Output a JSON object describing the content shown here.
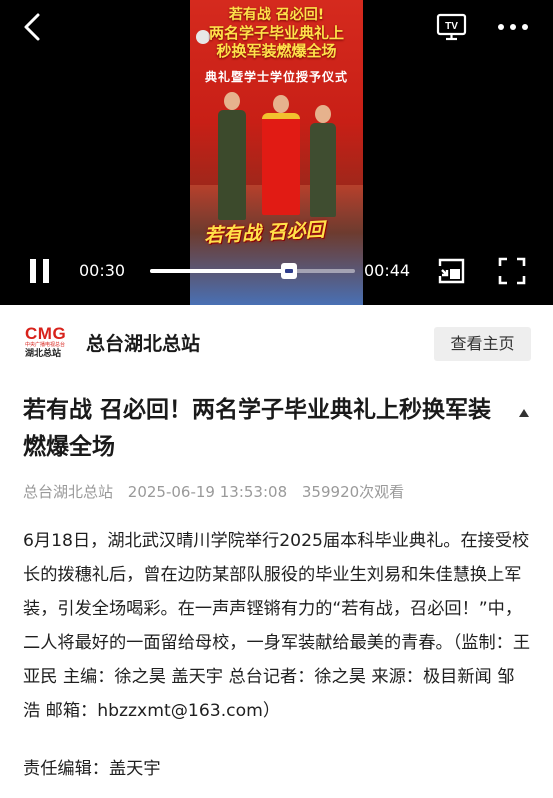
{
  "player": {
    "video_overlay_title_line1": "若有战 召必回!",
    "video_overlay_title_line2": "两名学子毕业典礼上",
    "video_overlay_title_line3": "秒换军装燃爆全场",
    "video_banner": "典礼暨学士学位授予仪式",
    "video_caption": "若有战 召必回",
    "current_time": "00:30",
    "total_time": "00:44",
    "progress_fraction": 0.68,
    "icons": {
      "back": "back-arrow-icon",
      "tv": "tv-cast-icon",
      "more": "more-dots-icon",
      "pause": "pause-icon",
      "pip": "picture-in-picture-icon",
      "fullscreen": "fullscreen-icon"
    },
    "tv_icon_label": "TV"
  },
  "channel": {
    "logo_text": "CMG",
    "logo_subtitle": "中央广播电视总台",
    "logo_name": "湖北总站",
    "name": "总台湖北总站",
    "home_button": "查看主页"
  },
  "article": {
    "title": "若有战 召必回！两名学子毕业典礼上秒换军装燃爆全场",
    "source": "总台湖北总站",
    "datetime": "2025-06-19 13:53:08",
    "views": "359920次观看",
    "body": "6月18日，湖北武汉晴川学院举行2025届本科毕业典礼。在接受校长的拨穗礼后，曾在边防某部队服役的毕业生刘易和朱佳慧换上军装，引发全场喝彩。在一声声铿锵有力的“若有战，召必回！”中，二人将最好的一面留给母校，一身军装献给最美的青春。（监制：王亚民 主编：徐之昊 盖天宇 总台记者：徐之昊 来源：极目新闻 邹浩 邮箱：hbzzxmt@163.com）",
    "editor": "责任编辑：盖天宇"
  },
  "colors": {
    "brand_red": "#d8221b",
    "meta_gray": "#9a9a9a",
    "progress_knob": "#2f3d8c"
  }
}
